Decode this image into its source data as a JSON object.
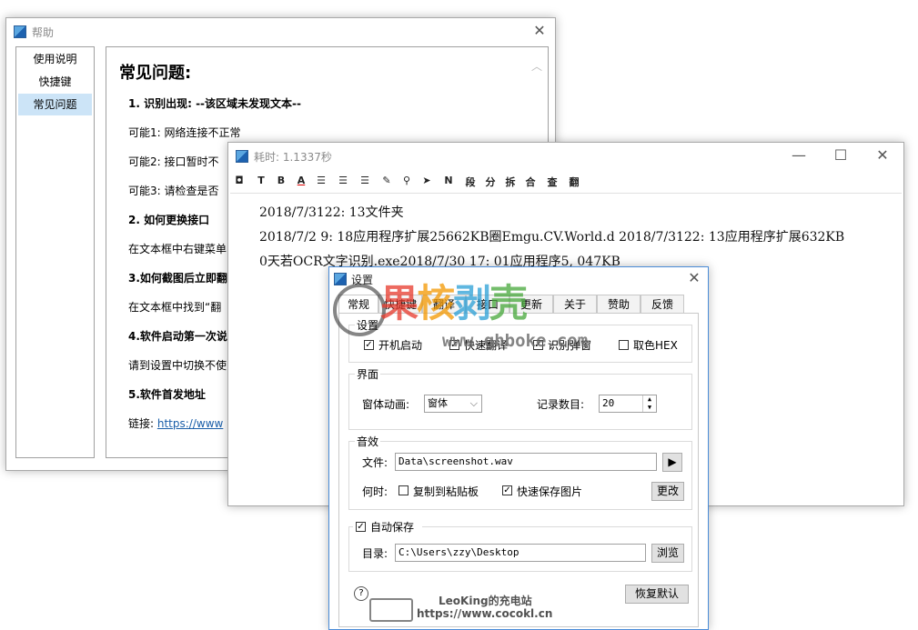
{
  "help_window": {
    "title": "帮助",
    "close": "✕",
    "nav": [
      "使用说明",
      "快捷键",
      "常见问题"
    ],
    "heading": "常见问题:",
    "lines": [
      "1. 识别出现: --该区域未发现文本--",
      "可能1: 网络连接不正常",
      "可能2: 接口暂时不",
      "可能3: 请检查是否",
      "2. 如何更换接口",
      "在文本框中右键菜单",
      "3.如何截图后立即翻",
      "在文本框中找到“翻",
      "4.软件启动第一次说",
      "请到设置中切换不使",
      "5.软件首发地址"
    ],
    "link_label": "链接:",
    "link_text": "https://www"
  },
  "timing_window": {
    "title": "耗时: 1.1337秒",
    "minimize": "—",
    "maximize": "☐",
    "close": "✕",
    "toolbar": [
      "◘",
      "T",
      "B",
      "A",
      "☰",
      "☰",
      "☰",
      "✎",
      "⚲",
      "➤",
      "N",
      "段",
      "分",
      "拆",
      "合",
      "查",
      "翻"
    ],
    "text_lines": [
      "2018/7/3122: 13文件夹",
      "2018/7/2 9: 18应用程序扩展25662KB圈Emgu.CV.World.d 2018/7/3122: 13应用程序扩展632KB",
      "0天若OCR文字识别.exe2018/7/30 17: 01应用程序5, 047KB"
    ]
  },
  "settings_window": {
    "title": "设置",
    "close": "✕",
    "tabs": [
      "常规",
      "快捷键",
      "翻译",
      "接口",
      "更新",
      "关于",
      "赞助",
      "反馈"
    ],
    "startup_group": "设置",
    "startup_checks": [
      {
        "label": "开机启动",
        "checked": true
      },
      {
        "label": "快速翻译",
        "checked": true
      },
      {
        "label": "识别弹窗",
        "checked": true
      },
      {
        "label": "取色HEX",
        "checked": false
      }
    ],
    "ui_group": "界面",
    "animation_label": "窗体动画:",
    "animation_value": "窗体",
    "records_label": "记录数目:",
    "records_value": "20",
    "sound_group": "音效",
    "file_label": "文件:",
    "file_value": "Data\\screenshot.wav",
    "play_icon": "▶",
    "when_label": "何时:",
    "copy_clip_label": "复制到粘贴板",
    "copy_clip_checked": false,
    "fast_save_label": "快速保存图片",
    "fast_save_checked": true,
    "change_button": "更改",
    "autosave_label": "自动保存",
    "autosave_checked": true,
    "dir_label": "目录:",
    "dir_value": "C:\\Users\\zzy\\Desktop",
    "browse_button": "浏览",
    "help_icon": "?",
    "restore_button": "恢复默认"
  },
  "watermark": {
    "brand": "果核剥壳",
    "url": "www.ghboke.com",
    "footer_name": "LeoKing的充电站",
    "footer_url": "https://www.cocokl.cn",
    "brand_colors": [
      "#e8392b",
      "#f39800",
      "#2a9fd6",
      "#46a83a"
    ]
  }
}
